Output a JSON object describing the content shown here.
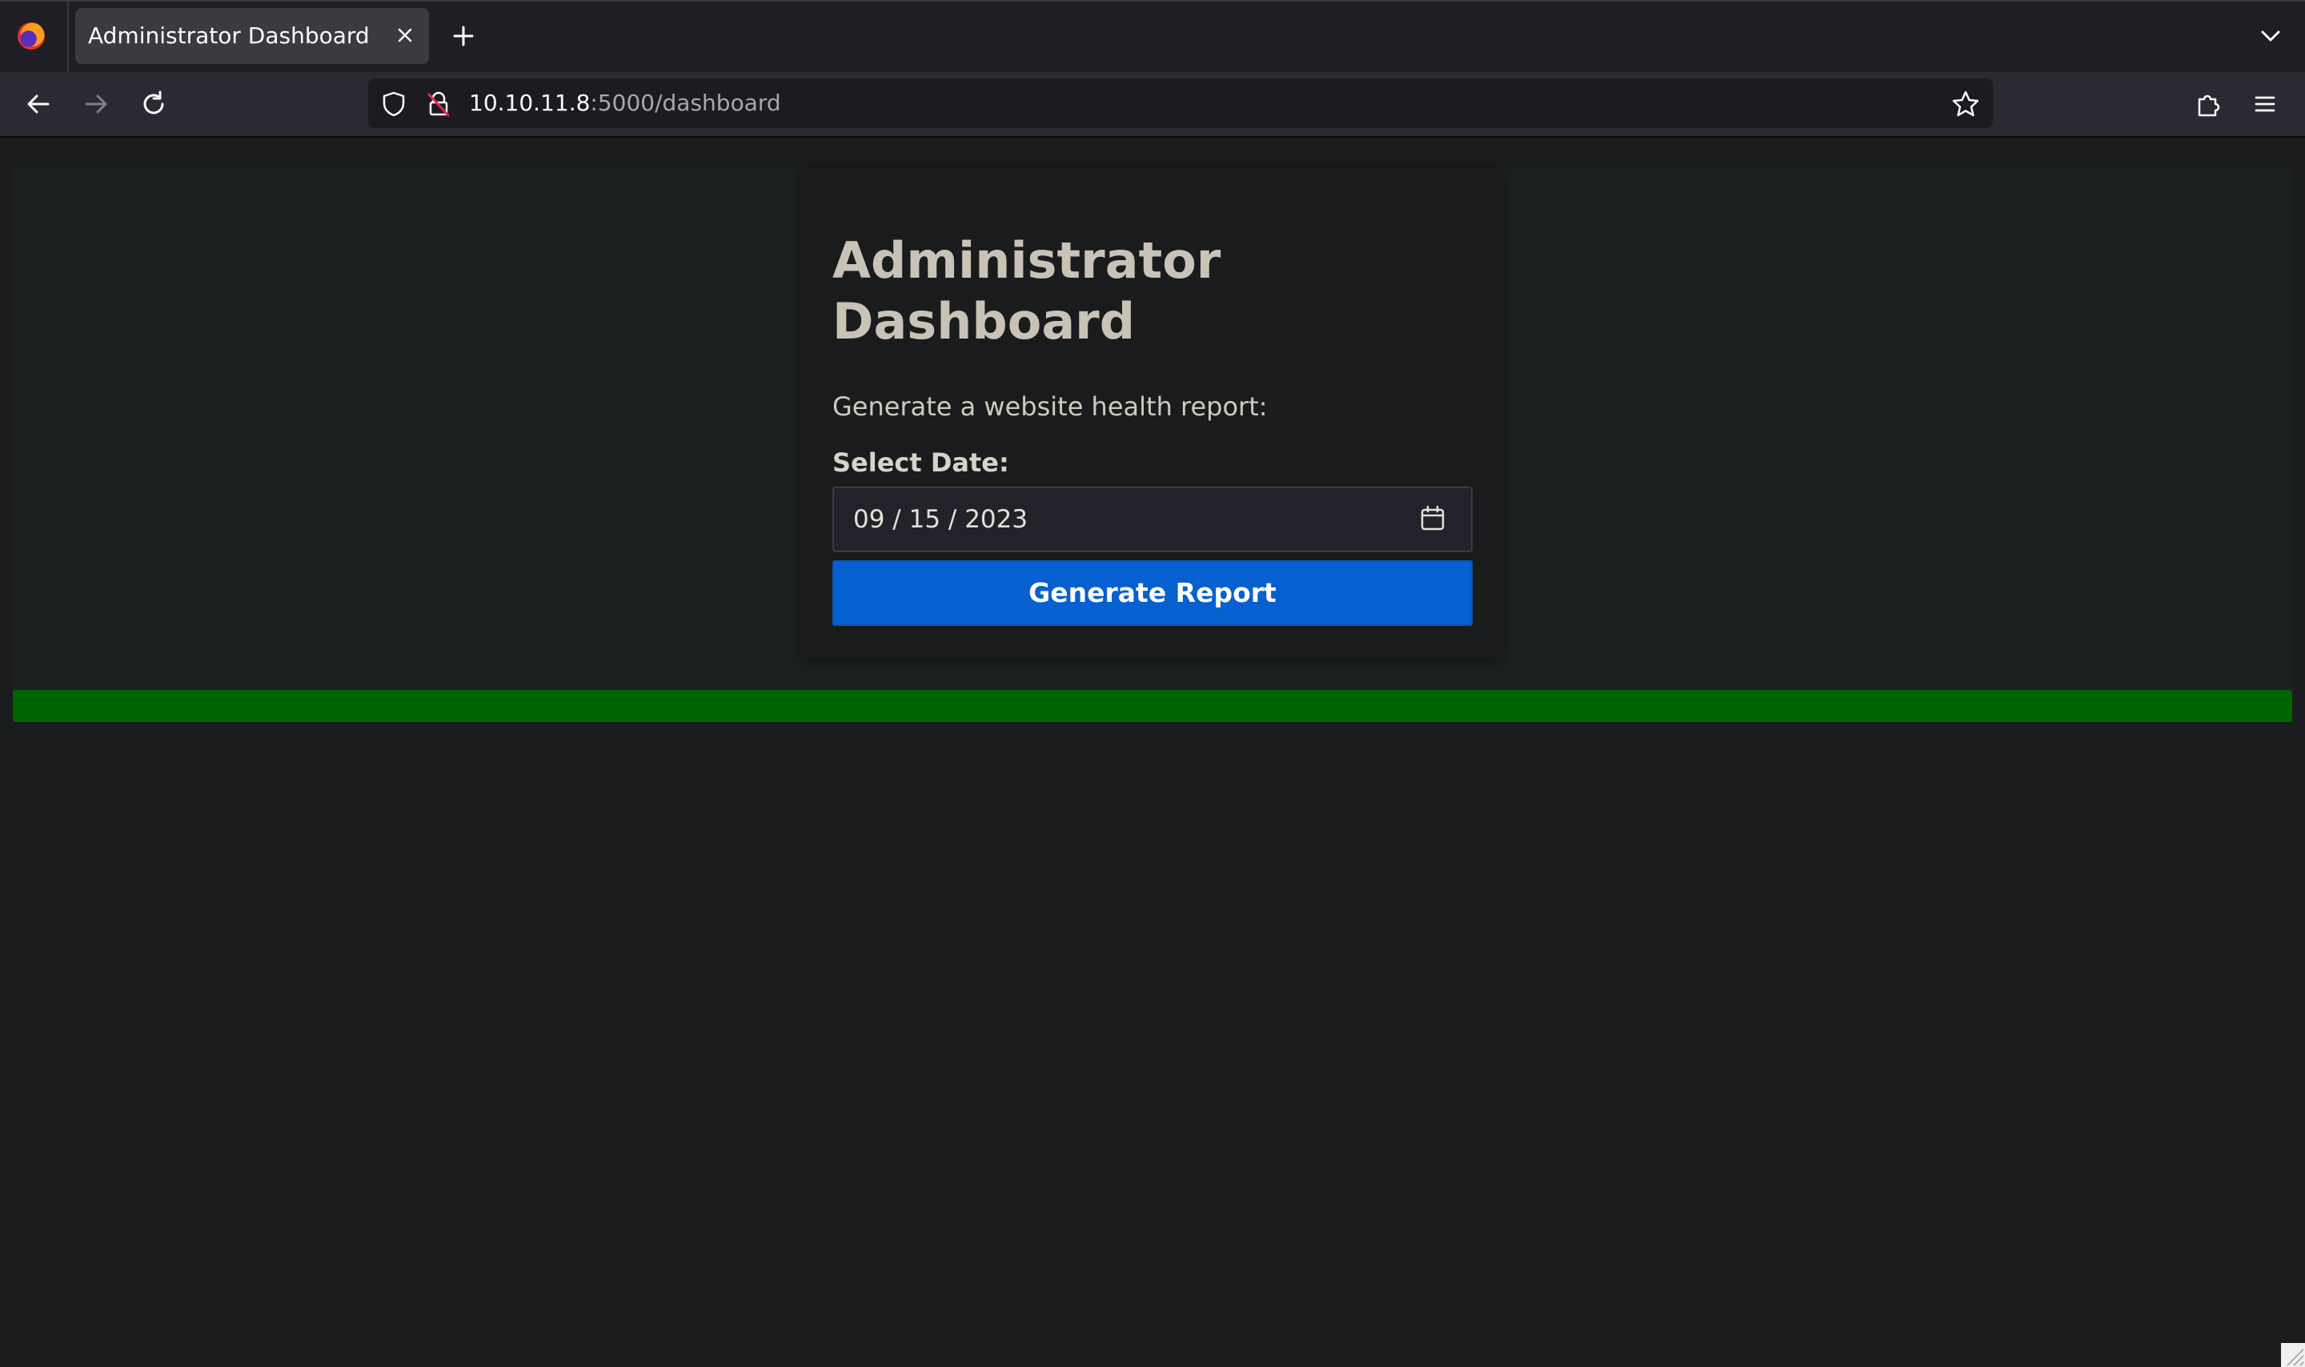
{
  "browser": {
    "tab": {
      "title": "Administrator Dashboard"
    },
    "url": {
      "host": "10.10.11.8",
      "rest": ":5000/dashboard"
    },
    "icons": {
      "logo": "firefox-logo-icon",
      "close": "close-icon",
      "new_tab": "plus-icon",
      "tab_list": "chevron-down-icon",
      "back": "arrow-left-icon",
      "forward": "arrow-right-icon",
      "reload": "reload-icon",
      "shield": "shield-icon",
      "lock": "insecure-lock-icon",
      "bookmark": "star-icon",
      "extensions": "puzzle-icon",
      "menu": "hamburger-menu-icon"
    }
  },
  "page": {
    "title": "Administrator Dashboard",
    "subtitle": "Generate a website health report:",
    "date_label": "Select Date:",
    "date_value": "09 / 15 / 2023",
    "generate_button": "Generate Report",
    "status_bar_color": "#006400",
    "accent_color": "#0660d0"
  }
}
